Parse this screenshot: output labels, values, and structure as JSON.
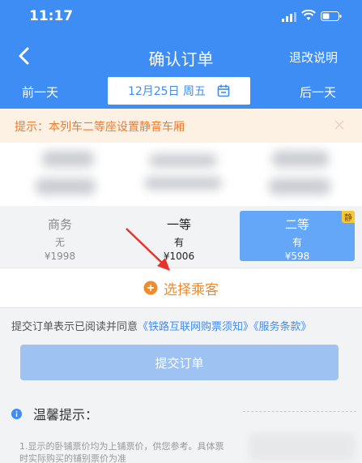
{
  "status": {
    "time": "11:17"
  },
  "nav": {
    "title": "确认订单",
    "refund_link": "退改说明"
  },
  "date_row": {
    "prev": "前一天",
    "date": "12月25日 周五",
    "next": "后一天"
  },
  "notice": {
    "text": "提示：本列车二等座设置静音车厢"
  },
  "seats": [
    {
      "name": "商务",
      "availability": "无",
      "price": "¥1998"
    },
    {
      "name": "一等",
      "availability": "有",
      "price": "¥1006"
    },
    {
      "name": "二等",
      "availability": "有",
      "price": "¥598",
      "selected": true,
      "badge": "静"
    }
  ],
  "passenger": {
    "label": "选择乘客"
  },
  "agreement": {
    "prefix": "提交订单表示已阅读并同意",
    "link1": "《铁路互联网购票须知》",
    "link2": "《服务条款》"
  },
  "submit": {
    "label": "提交订单"
  },
  "tips": {
    "title": "温馨提示：",
    "line1": "1.显示的卧铺票价均为上铺票价，供您参考。具体票",
    "line2": "时实际购买的铺别票价为准"
  },
  "colors": {
    "header": "#3d8df5",
    "selected_seat": "#64a6f7",
    "accent_orange": "#f08a2a",
    "notice_bg": "#fdf1e4"
  },
  "icons": [
    "back-icon",
    "calendar-icon",
    "close-icon",
    "plus-circle-icon",
    "info-icon",
    "signal-icon",
    "wifi-icon",
    "battery-icon"
  ]
}
